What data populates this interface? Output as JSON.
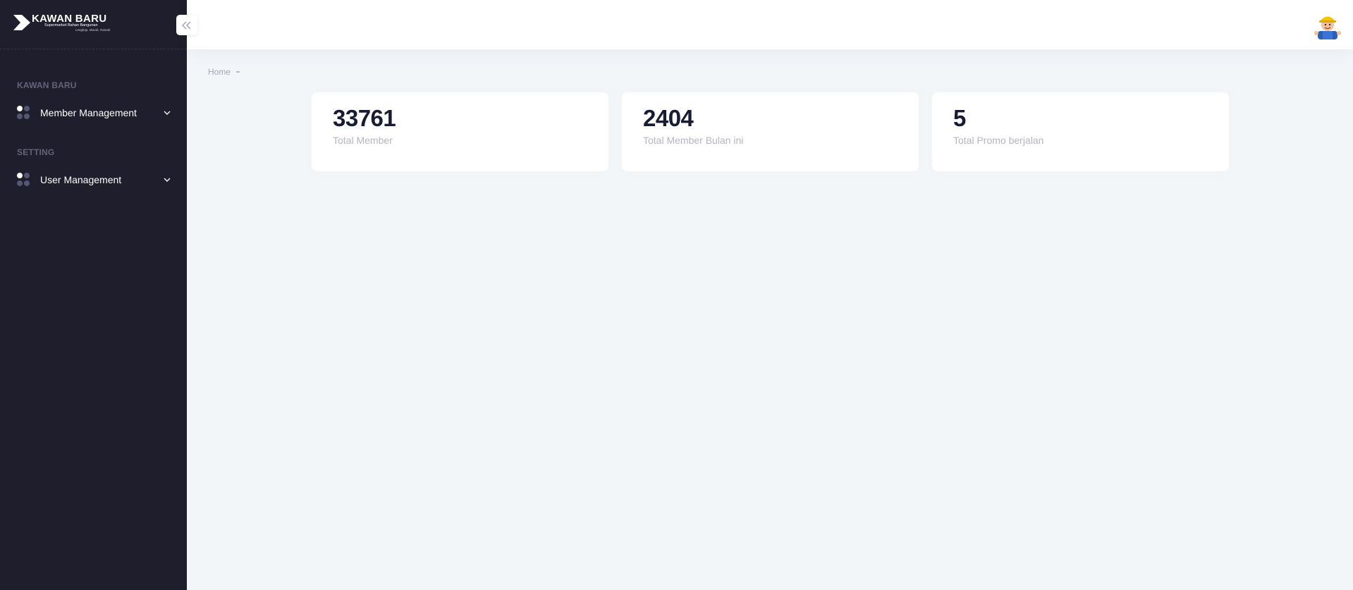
{
  "brand": {
    "title": "KAWAN BARU",
    "subtitle": "Supermarket Bahan Bangunan",
    "tagline": "Lengkap, Murah, Ramah"
  },
  "sidebar": {
    "sections": [
      {
        "label": "KAWAN BARU",
        "items": [
          {
            "label": "Member Management",
            "icon": "dots-grid-icon"
          }
        ]
      },
      {
        "label": "SETTING",
        "items": [
          {
            "label": "User Management",
            "icon": "dots-grid-icon"
          }
        ]
      }
    ]
  },
  "breadcrumb": {
    "home": "Home"
  },
  "stats": [
    {
      "value": "33761",
      "label": "Total Member"
    },
    {
      "value": "2404",
      "label": "Total Member Bulan ini"
    },
    {
      "value": "5",
      "label": "Total Promo berjalan"
    }
  ],
  "colors": {
    "sidebar_bg": "#1e1e2d",
    "page_bg": "#f3f6f9",
    "card_bg": "#ffffff",
    "value_text": "#181c32",
    "muted_text": "#b5b5c3"
  }
}
